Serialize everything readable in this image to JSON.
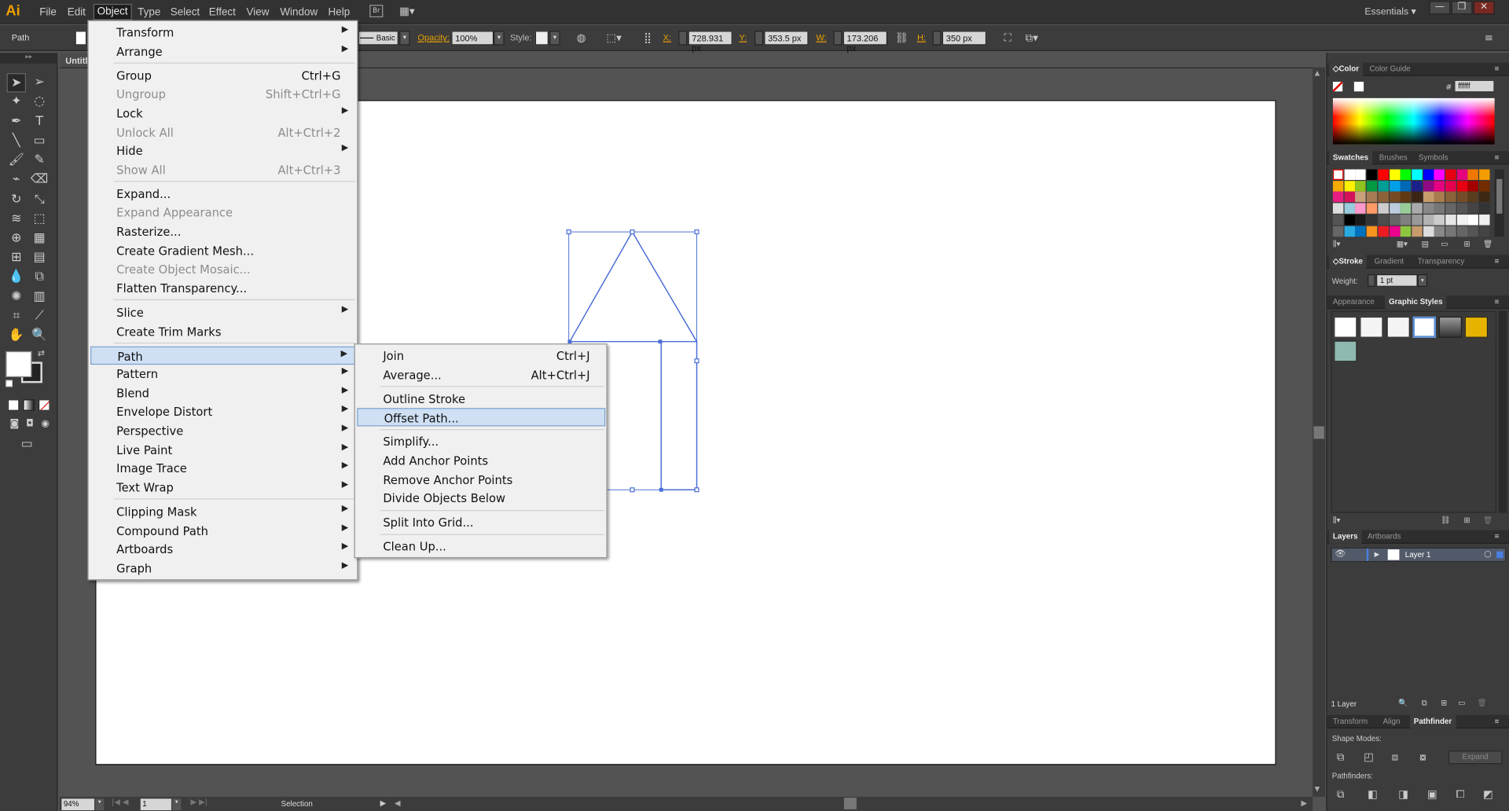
{
  "app": {
    "logo": "Ai",
    "workspace": "Essentials",
    "doc_tab": "Untitl"
  },
  "menubar": [
    "File",
    "Edit",
    "Object",
    "Type",
    "Select",
    "Effect",
    "View",
    "Window",
    "Help"
  ],
  "control": {
    "selection_label": "Path",
    "stroke_profile": "Basic",
    "opacity_label": "Opacity:",
    "opacity_value": "100%",
    "style_label": "Style:",
    "x_label": "X:",
    "x_value": "728.931 px",
    "y_label": "Y:",
    "y_value": "353.5 px",
    "w_label": "W:",
    "w_value": "173.206 px",
    "h_label": "H:",
    "h_value": "350 px"
  },
  "object_menu": [
    {
      "label": "Transform",
      "submenu": true
    },
    {
      "label": "Arrange",
      "submenu": true
    },
    {
      "sep": true
    },
    {
      "label": "Group",
      "shortcut": "Ctrl+G"
    },
    {
      "label": "Ungroup",
      "shortcut": "Shift+Ctrl+G",
      "disabled": true
    },
    {
      "label": "Lock",
      "submenu": true
    },
    {
      "label": "Unlock All",
      "shortcut": "Alt+Ctrl+2",
      "disabled": true
    },
    {
      "label": "Hide",
      "submenu": true
    },
    {
      "label": "Show All",
      "shortcut": "Alt+Ctrl+3",
      "disabled": true
    },
    {
      "sep": true
    },
    {
      "label": "Expand..."
    },
    {
      "label": "Expand Appearance",
      "disabled": true
    },
    {
      "label": "Rasterize..."
    },
    {
      "label": "Create Gradient Mesh..."
    },
    {
      "label": "Create Object Mosaic...",
      "disabled": true
    },
    {
      "label": "Flatten Transparency..."
    },
    {
      "sep": true
    },
    {
      "label": "Slice",
      "submenu": true
    },
    {
      "label": "Create Trim Marks"
    },
    {
      "sep": true
    },
    {
      "label": "Path",
      "submenu": true,
      "highlighted": true
    },
    {
      "label": "Pattern",
      "submenu": true
    },
    {
      "label": "Blend",
      "submenu": true
    },
    {
      "label": "Envelope Distort",
      "submenu": true
    },
    {
      "label": "Perspective",
      "submenu": true
    },
    {
      "label": "Live Paint",
      "submenu": true
    },
    {
      "label": "Image Trace",
      "submenu": true
    },
    {
      "label": "Text Wrap",
      "submenu": true
    },
    {
      "sep": true
    },
    {
      "label": "Clipping Mask",
      "submenu": true
    },
    {
      "label": "Compound Path",
      "submenu": true
    },
    {
      "label": "Artboards",
      "submenu": true
    },
    {
      "label": "Graph",
      "submenu": true
    }
  ],
  "path_menu": [
    {
      "label": "Join",
      "shortcut": "Ctrl+J"
    },
    {
      "label": "Average...",
      "shortcut": "Alt+Ctrl+J"
    },
    {
      "sep": true
    },
    {
      "label": "Outline Stroke"
    },
    {
      "label": "Offset Path...",
      "highlighted": true
    },
    {
      "sep": true
    },
    {
      "label": "Simplify..."
    },
    {
      "label": "Add Anchor Points"
    },
    {
      "label": "Remove Anchor Points"
    },
    {
      "label": "Divide Objects Below"
    },
    {
      "sep": true
    },
    {
      "label": "Split Into Grid..."
    },
    {
      "sep": true
    },
    {
      "label": "Clean Up..."
    }
  ],
  "panels": {
    "color_tabs": [
      "Color",
      "Color Guide"
    ],
    "hex_value": "ffffff",
    "swatch_tabs": [
      "Swatches",
      "Brushes",
      "Symbols"
    ],
    "stroke_tabs": [
      "Stroke",
      "Gradient",
      "Transparency"
    ],
    "weight_label": "Weight:",
    "weight_value": "1 pt",
    "appearance_tabs": [
      "Appearance",
      "Graphic Styles"
    ],
    "layers_tabs": [
      "Layers",
      "Artboards"
    ],
    "layer_name": "Layer 1",
    "layers_count": "1 Layer",
    "transform_tabs": [
      "Transform",
      "Align",
      "Pathfinder"
    ],
    "shape_modes_label": "Shape Modes:",
    "expand_label": "Expand",
    "pathfinders_label": "Pathfinders:"
  },
  "status": {
    "zoom": "94%",
    "artboard": "1",
    "tool": "Selection"
  },
  "colors": {
    "accent": "#e8a000",
    "selection_blue": "#4a6fd6",
    "menu_highlight": "#cfe0f4"
  }
}
